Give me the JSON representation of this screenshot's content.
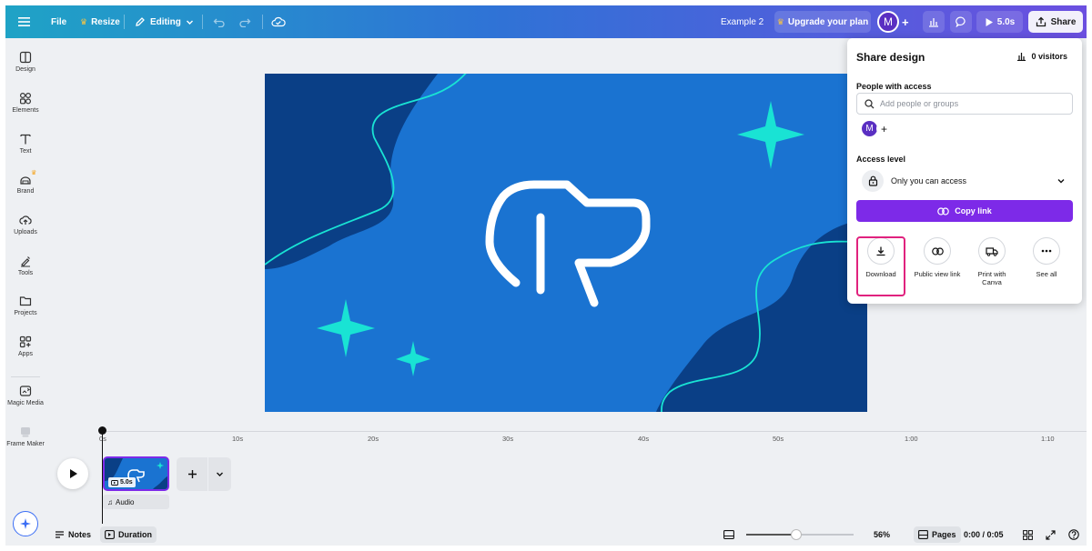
{
  "topbar": {
    "file": "File",
    "resize": "Resize",
    "editing": "Editing",
    "title": "Example 2",
    "upgrade": "Upgrade your plan",
    "avatar_initial": "M",
    "play_duration": "5.0s",
    "share": "Share"
  },
  "sidebar": {
    "items": [
      {
        "label": "Design",
        "icon": "design-icon"
      },
      {
        "label": "Elements",
        "icon": "elements-icon"
      },
      {
        "label": "Text",
        "icon": "text-icon"
      },
      {
        "label": "Brand",
        "icon": "brand-icon"
      },
      {
        "label": "Uploads",
        "icon": "uploads-icon"
      },
      {
        "label": "Tools",
        "icon": "tools-icon"
      },
      {
        "label": "Projects",
        "icon": "projects-icon"
      },
      {
        "label": "Apps",
        "icon": "apps-icon"
      },
      {
        "label": "Magic Media",
        "icon": "magic-media-icon"
      },
      {
        "label": "Frame Maker",
        "icon": "frame-maker-icon"
      }
    ]
  },
  "share_panel": {
    "title": "Share design",
    "visitors": "0 visitors",
    "people_label": "People with access",
    "search_placeholder": "Add people or groups",
    "avatar_initial": "M",
    "access_label": "Access level",
    "access_value": "Only you can access",
    "copy_link": "Copy link",
    "options": [
      {
        "label": "Download",
        "icon": "download-icon"
      },
      {
        "label": "Public view link",
        "icon": "link-icon"
      },
      {
        "label": "Print with Canva",
        "icon": "truck-icon"
      },
      {
        "label": "See all",
        "icon": "more-icon"
      }
    ]
  },
  "timeline": {
    "ticks": [
      "0s",
      "10s",
      "20s",
      "30s",
      "40s",
      "50s",
      "1:00",
      "1:10"
    ],
    "clip_duration": "5.0s",
    "audio_label": "Audio"
  },
  "bottombar": {
    "notes": "Notes",
    "duration": "Duration",
    "zoom": "56%",
    "zoom_level": 0.47,
    "pages": "Pages",
    "time": "0:00 / 0:05"
  },
  "colors": {
    "accent": "#7d2ae8",
    "canvas_bg": "#1a73d1",
    "canvas_dark": "#0a3f86",
    "teal": "#19e3d4",
    "highlight": "#e0227e"
  }
}
